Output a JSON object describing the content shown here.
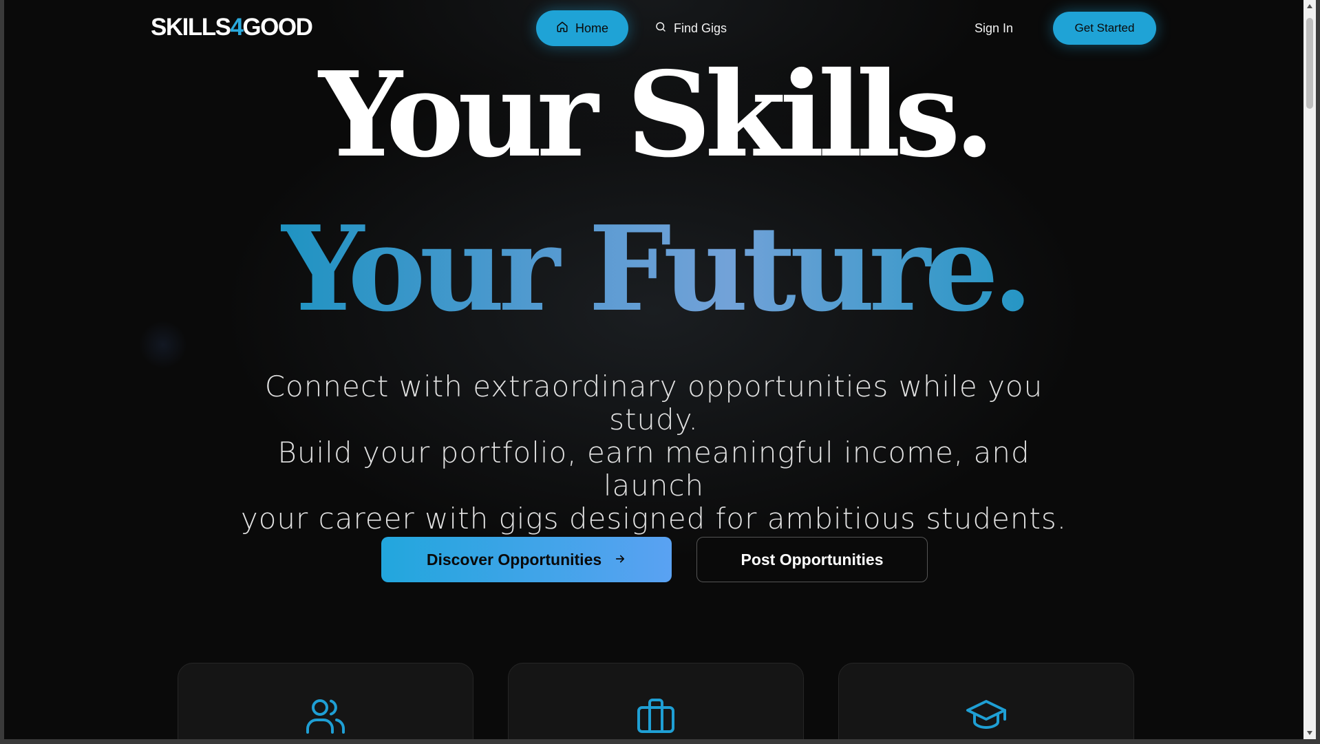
{
  "nav": {
    "logo_prefix": "SKILLS",
    "logo_accent": "4",
    "logo_suffix": "GOOD",
    "home_label": "Home",
    "find_gigs_label": "Find Gigs",
    "sign_in_label": "Sign In",
    "get_started_label": "Get Started"
  },
  "hero": {
    "headline_line1": "Your Skills.",
    "headline_line2": "Your Future.",
    "subcopy_line1": "Connect with extraordinary opportunities while you study.",
    "subcopy_line2": "Build your portfolio, earn meaningful income, and launch",
    "subcopy_line3": "your career with gigs designed for ambitious students.",
    "primary_cta": "Discover Opportunities",
    "secondary_cta": "Post Opportunities"
  },
  "features": [
    {
      "icon": "users-icon"
    },
    {
      "icon": "briefcase-icon"
    },
    {
      "icon": "graduation-cap-icon"
    }
  ],
  "colors": {
    "accent": "#1fa3d6",
    "background": "#0a0a0a",
    "card": "#151515"
  }
}
